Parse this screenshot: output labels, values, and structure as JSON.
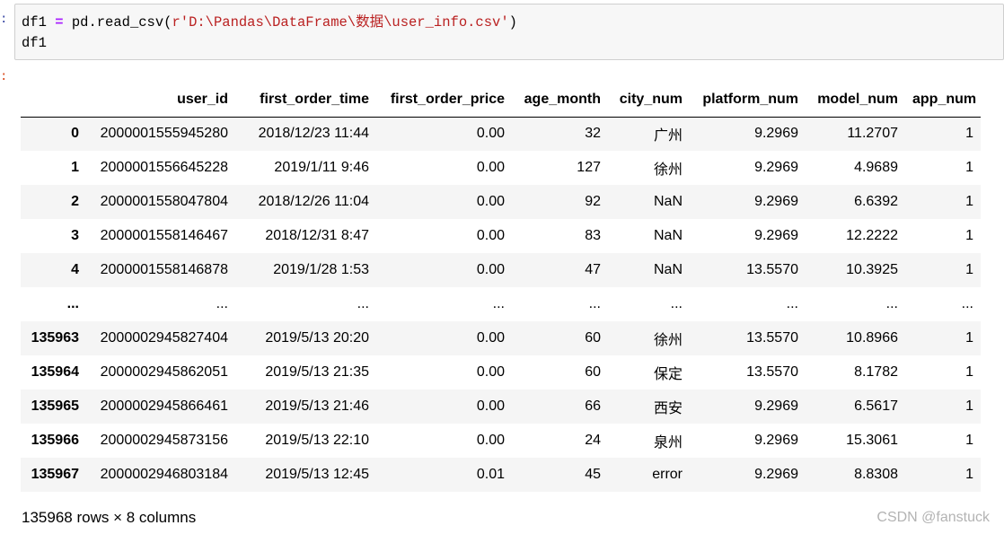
{
  "prompts": {
    "input": ":",
    "output": ":"
  },
  "code": {
    "var": "df1",
    "eq": "=",
    "call_prefix": "pd.read_csv(",
    "string": "r'D:\\Pandas\\DataFrame\\数据\\user_info.csv'",
    "call_suffix": ")",
    "line2": "df1"
  },
  "table": {
    "columns": [
      "user_id",
      "first_order_time",
      "first_order_price",
      "age_month",
      "city_num",
      "platform_num",
      "model_num",
      "app_num"
    ],
    "rows": [
      {
        "index": "0",
        "cells": [
          "2000001555945280",
          "2018/12/23 11:44",
          "0.00",
          "32",
          "广州",
          "9.2969",
          "11.2707",
          "1"
        ]
      },
      {
        "index": "1",
        "cells": [
          "2000001556645228",
          "2019/1/11 9:46",
          "0.00",
          "127",
          "徐州",
          "9.2969",
          "4.9689",
          "1"
        ]
      },
      {
        "index": "2",
        "cells": [
          "2000001558047804",
          "2018/12/26 11:04",
          "0.00",
          "92",
          "NaN",
          "9.2969",
          "6.6392",
          "1"
        ]
      },
      {
        "index": "3",
        "cells": [
          "2000001558146467",
          "2018/12/31 8:47",
          "0.00",
          "83",
          "NaN",
          "9.2969",
          "12.2222",
          "1"
        ]
      },
      {
        "index": "4",
        "cells": [
          "2000001558146878",
          "2019/1/28 1:53",
          "0.00",
          "47",
          "NaN",
          "13.5570",
          "10.3925",
          "1"
        ]
      },
      {
        "index": "...",
        "cells": [
          "...",
          "...",
          "...",
          "...",
          "...",
          "...",
          "...",
          "..."
        ]
      },
      {
        "index": "135963",
        "cells": [
          "2000002945827404",
          "2019/5/13 20:20",
          "0.00",
          "60",
          "徐州",
          "13.5570",
          "10.8966",
          "1"
        ]
      },
      {
        "index": "135964",
        "cells": [
          "2000002945862051",
          "2019/5/13 21:35",
          "0.00",
          "60",
          "保定",
          "13.5570",
          "8.1782",
          "1"
        ]
      },
      {
        "index": "135965",
        "cells": [
          "2000002945866461",
          "2019/5/13 21:46",
          "0.00",
          "66",
          "西安",
          "9.2969",
          "6.5617",
          "1"
        ]
      },
      {
        "index": "135966",
        "cells": [
          "2000002945873156",
          "2019/5/13 22:10",
          "0.00",
          "24",
          "泉州",
          "9.2969",
          "15.3061",
          "1"
        ]
      },
      {
        "index": "135967",
        "cells": [
          "2000002946803184",
          "2019/5/13 12:45",
          "0.01",
          "45",
          "error",
          "9.2969",
          "8.8308",
          "1"
        ]
      }
    ]
  },
  "footer": "135968 rows × 8 columns",
  "watermark": "CSDN @fanstuck"
}
